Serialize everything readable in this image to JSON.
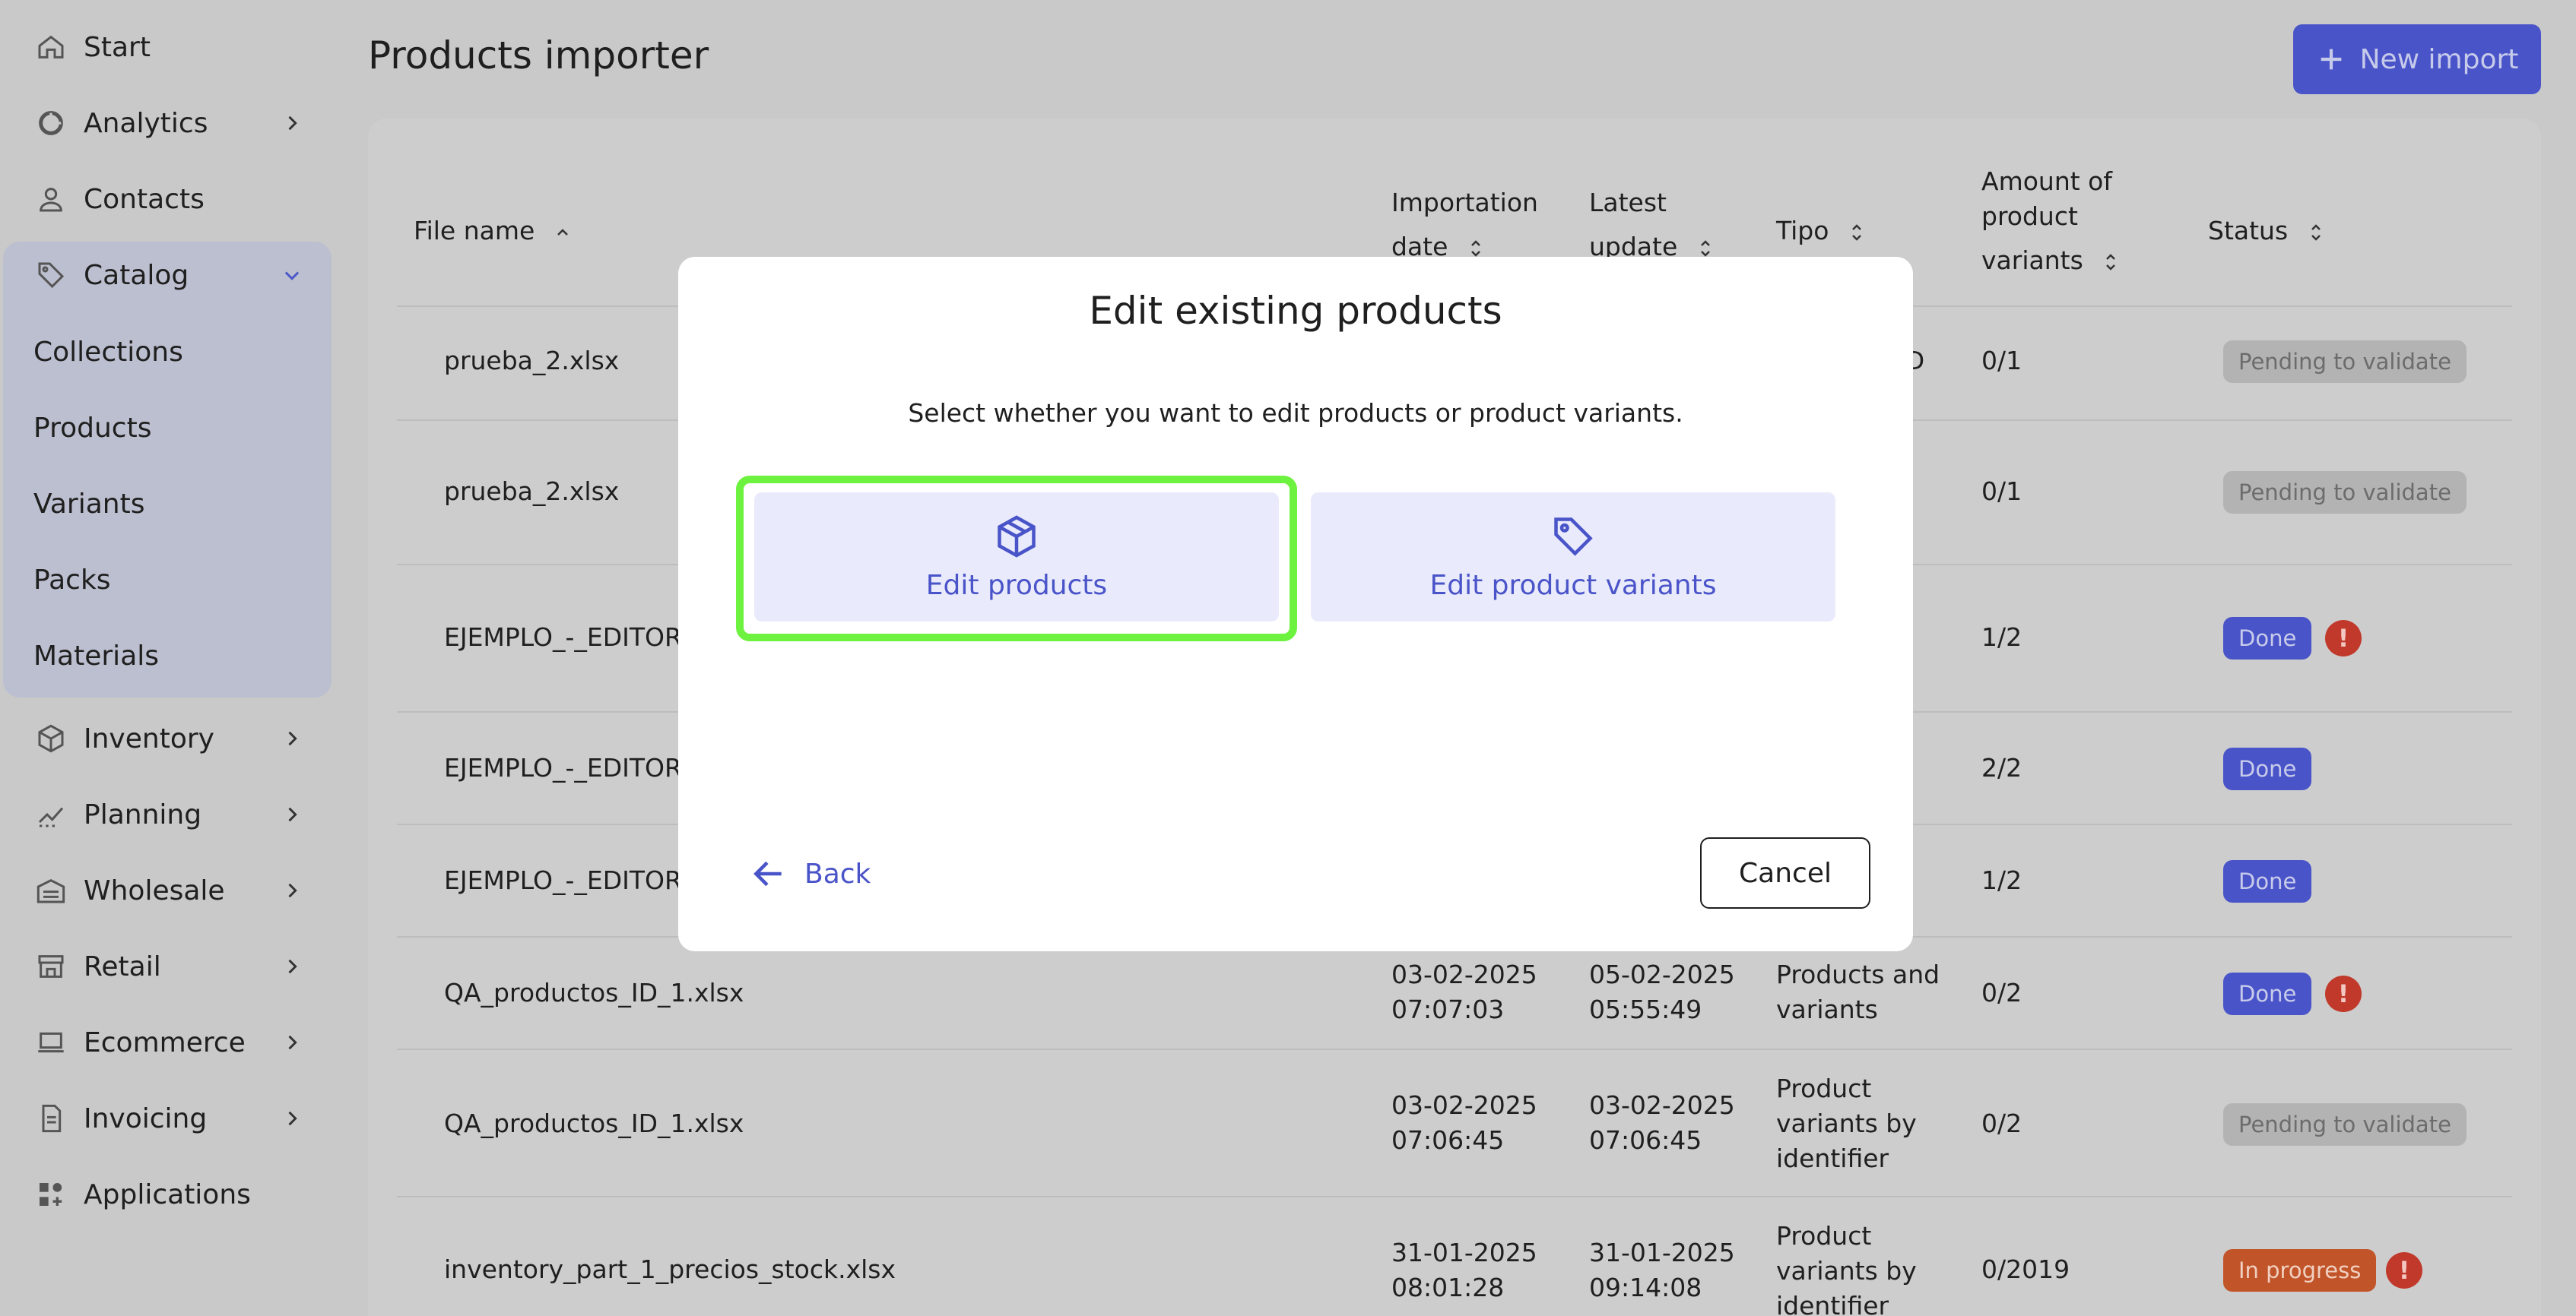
{
  "sidebar": {
    "items": [
      {
        "label": "Start",
        "icon": "home-icon"
      },
      {
        "label": "Analytics",
        "icon": "analytics-icon"
      },
      {
        "label": "Contacts",
        "icon": "person-icon"
      },
      {
        "label": "Catalog",
        "icon": "tag-icon"
      },
      {
        "label": "Inventory",
        "icon": "box-icon"
      },
      {
        "label": "Planning",
        "icon": "trend-icon"
      },
      {
        "label": "Wholesale",
        "icon": "warehouse-icon"
      },
      {
        "label": "Retail",
        "icon": "store-icon"
      },
      {
        "label": "Ecommerce",
        "icon": "laptop-icon"
      },
      {
        "label": "Invoicing",
        "icon": "document-icon"
      },
      {
        "label": "Applications",
        "icon": "apps-icon"
      }
    ],
    "catalog_sub": [
      "Collections",
      "Products",
      "Variants",
      "Packs",
      "Materials"
    ]
  },
  "header": {
    "title": "Products importer",
    "new_import_label": "New import"
  },
  "table": {
    "headers": {
      "file_name": "File name",
      "importation_date_1": "Importation",
      "importation_date_2": "date",
      "latest_update_1": "Latest",
      "latest_update_2": "update",
      "tipo": "Tipo",
      "amount_1": "Amount of",
      "amount_2": "product",
      "amount_3": "variants",
      "status": "Status"
    },
    "rows": [
      {
        "file": "prueba_2.xlsx",
        "imp1": "",
        "imp2": "",
        "upd1": "",
        "upd2": "",
        "tipo": [
          "ID"
        ],
        "amount": "0/1",
        "status": "Pending to validate",
        "kind": "pending",
        "warn": false
      },
      {
        "file": "prueba_2.xlsx",
        "imp1": "",
        "imp2": "",
        "upd1": "",
        "upd2": "",
        "tipo": [],
        "amount": "0/1",
        "status": "Pending to validate",
        "kind": "pending",
        "warn": false
      },
      {
        "file": "EJEMPLO_-_EDITOR",
        "imp1": "",
        "imp2": "",
        "upd1": "",
        "upd2": "",
        "tipo": [],
        "amount": "1/2",
        "status": "Done",
        "kind": "done",
        "warn": true
      },
      {
        "file": "EJEMPLO_-_EDITOR",
        "imp1": "",
        "imp2": "",
        "upd1": "",
        "upd2": "",
        "tipo": [],
        "amount": "2/2",
        "status": "Done",
        "kind": "done",
        "warn": false
      },
      {
        "file": "EJEMPLO_-_EDITOR",
        "imp1": "",
        "imp2": "",
        "upd1": "",
        "upd2": "",
        "tipo": [],
        "amount": "1/2",
        "status": "Done",
        "kind": "done",
        "warn": false
      },
      {
        "file": "QA_productos_ID_1.xlsx",
        "imp1": "03-02-2025",
        "imp2": "07:07:03",
        "upd1": "05-02-2025",
        "upd2": "05:55:49",
        "tipo": [
          "Products and",
          "variants"
        ],
        "amount": "0/2",
        "status": "Done",
        "kind": "done",
        "warn": true
      },
      {
        "file": "QA_productos_ID_1.xlsx",
        "imp1": "03-02-2025",
        "imp2": "07:06:45",
        "upd1": "03-02-2025",
        "upd2": "07:06:45",
        "tipo": [
          "Product",
          "variants by",
          "identifier"
        ],
        "amount": "0/2",
        "status": "Pending to validate",
        "kind": "pending",
        "warn": false
      },
      {
        "file": "inventory_part_1_precios_stock.xlsx",
        "imp1": "31-01-2025",
        "imp2": "08:01:28",
        "upd1": "31-01-2025",
        "upd2": "09:14:08",
        "tipo": [
          "Product",
          "variants by",
          "identifier"
        ],
        "amount": "0/2019",
        "status": "In progress",
        "kind": "progress",
        "warn": true
      }
    ]
  },
  "modal": {
    "title": "Edit existing products",
    "description": "Select whether you want to edit products or product variants.",
    "option_products": "Edit products",
    "option_variants": "Edit product variants",
    "back_label": "Back",
    "cancel_label": "Cancel"
  },
  "colors": {
    "accent": "#4a54c9",
    "highlight": "#6df23f",
    "warning": "#c0392b",
    "in_progress": "#c2542a"
  }
}
